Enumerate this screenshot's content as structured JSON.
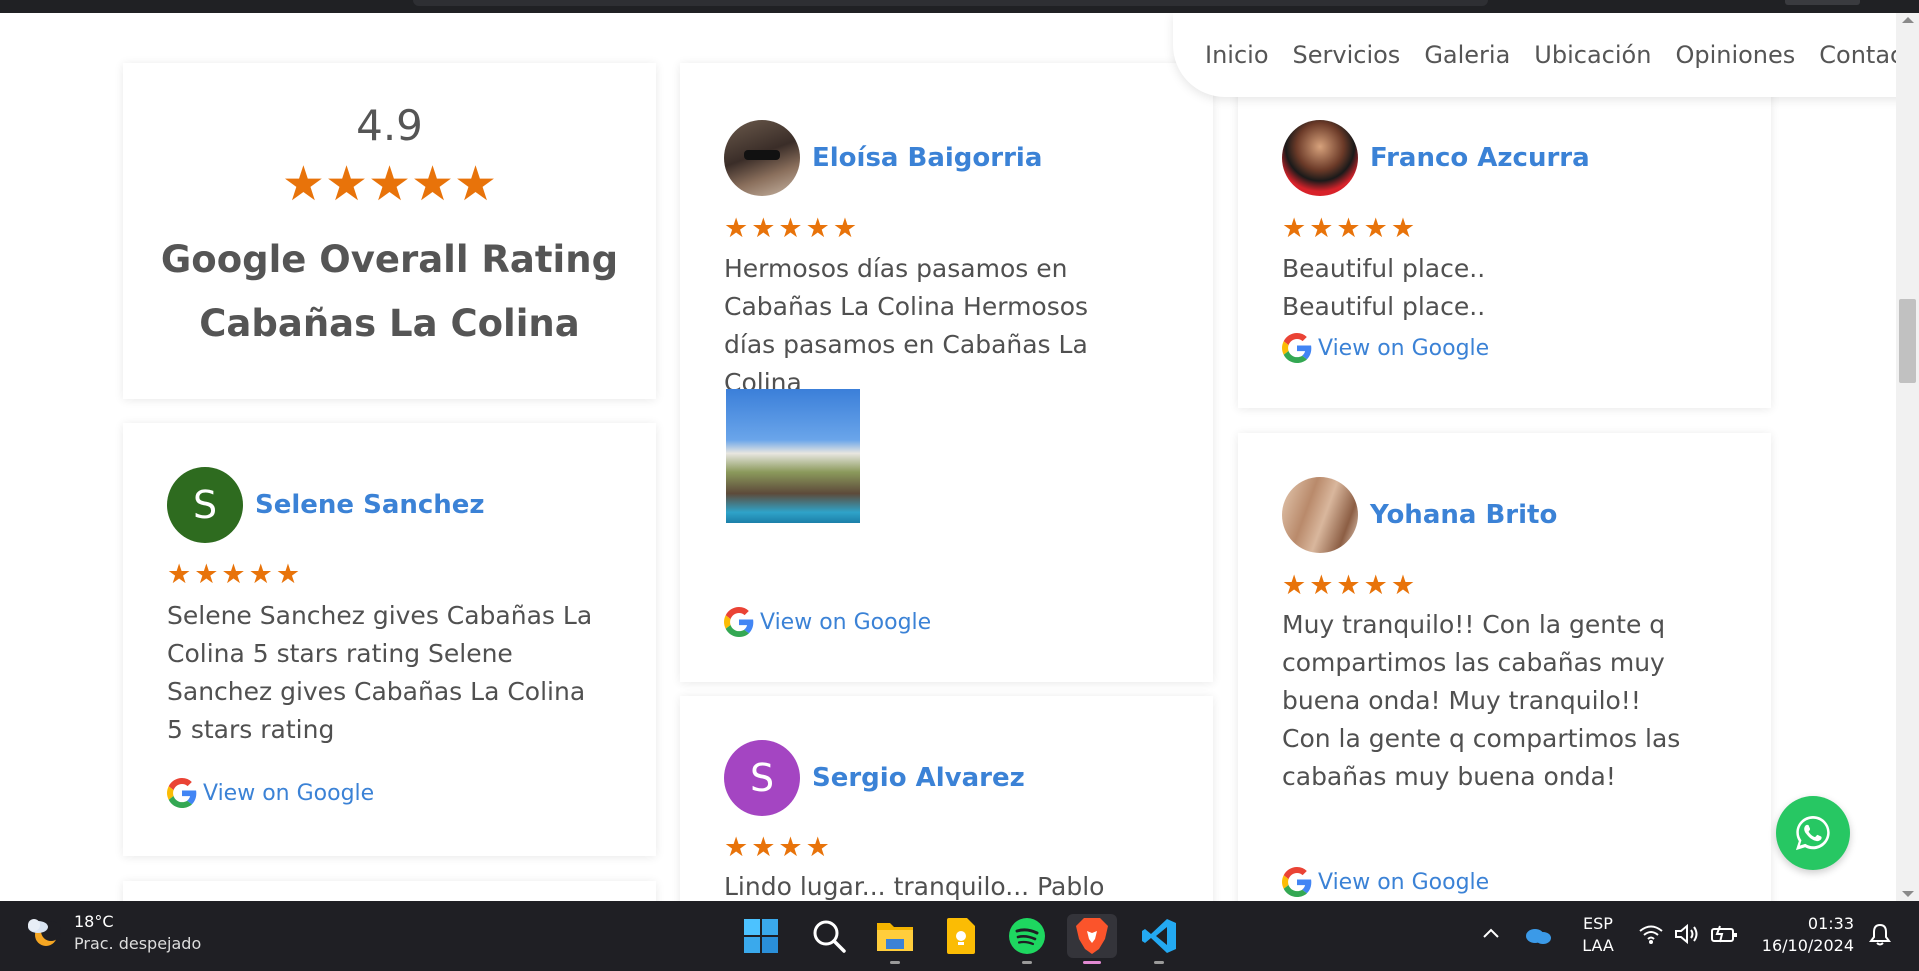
{
  "nav": {
    "items": [
      "Inicio",
      "Servicios",
      "Galeria",
      "Ubicación",
      "Opiniones",
      "Contacto"
    ]
  },
  "overall": {
    "score": "4.9",
    "stars": 5,
    "title_line1": "Google Overall Rating",
    "title_line2": "Cabañas La Colina"
  },
  "view_on_google": "View on Google",
  "reviews": [
    {
      "name": "Eloísa Baigorria",
      "stars": 5,
      "text": "Hermosos días pasamos en Cabañas La Colina Hermosos días pasamos en Cabañas La Colina",
      "has_photo": true
    },
    {
      "name": "Franco Azcurra",
      "stars": 5,
      "text": "Beautiful place.. Beautiful place.."
    },
    {
      "name": "Selene Sanchez",
      "initial": "S",
      "avatar_color": "#2e6b1f",
      "stars": 5,
      "text": "Selene Sanchez gives Cabañas La Colina 5 stars rating Selene Sanchez gives Cabañas La Colina 5 stars rating"
    },
    {
      "name": "Yohana Brito",
      "stars": 5,
      "text": "Muy tranquilo!! Con la gente q compartimos las cabañas muy buena onda! Muy tranquilo!! Con la gente q compartimos las cabañas muy buena onda!"
    },
    {
      "name": "Sergio Alvarez",
      "initial": "S",
      "avatar_color": "#a445c2",
      "stars": 4,
      "text": "Lindo lugar... tranquilo... Pablo"
    }
  ],
  "accent": {
    "star": "#e8730a",
    "link": "#3b82d6",
    "whatsapp": "#27c763"
  },
  "taskbar": {
    "weather_temp": "18°C",
    "weather_desc": "Prac. despejado",
    "apps": [
      "start-icon",
      "search-icon",
      "file-explorer-icon",
      "keep-notes-icon",
      "spotify-icon",
      "brave-browser-icon",
      "vscode-icon"
    ],
    "lang_top": "ESP",
    "lang_bottom": "LAA",
    "time": "01:33",
    "date": "16/10/2024"
  }
}
